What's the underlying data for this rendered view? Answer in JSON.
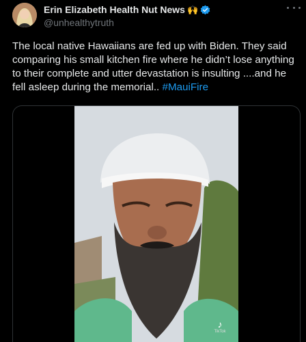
{
  "author": {
    "display_name": "Erin Elizabeth Health Nut News",
    "emoji": "🙌",
    "handle": "@unhealthytruth",
    "verified": true
  },
  "tweet": {
    "text": "The local native  Hawaiians are fed up with Biden. They said comparing his small kitchen fire where he didn’t lose anything to their complete and utter devastation is insulting ....and he fell asleep during the memorial.. ",
    "hashtag": "#MauiFire"
  },
  "media": {
    "watermark": "TikTok"
  },
  "icons": {
    "more": "more-horizontal-icon",
    "verified": "verified-badge-icon",
    "tiktok": "tiktok-icon"
  },
  "colors": {
    "background": "#000000",
    "text": "#e7e9ea",
    "muted": "#71767b",
    "link": "#1d9bf0"
  }
}
